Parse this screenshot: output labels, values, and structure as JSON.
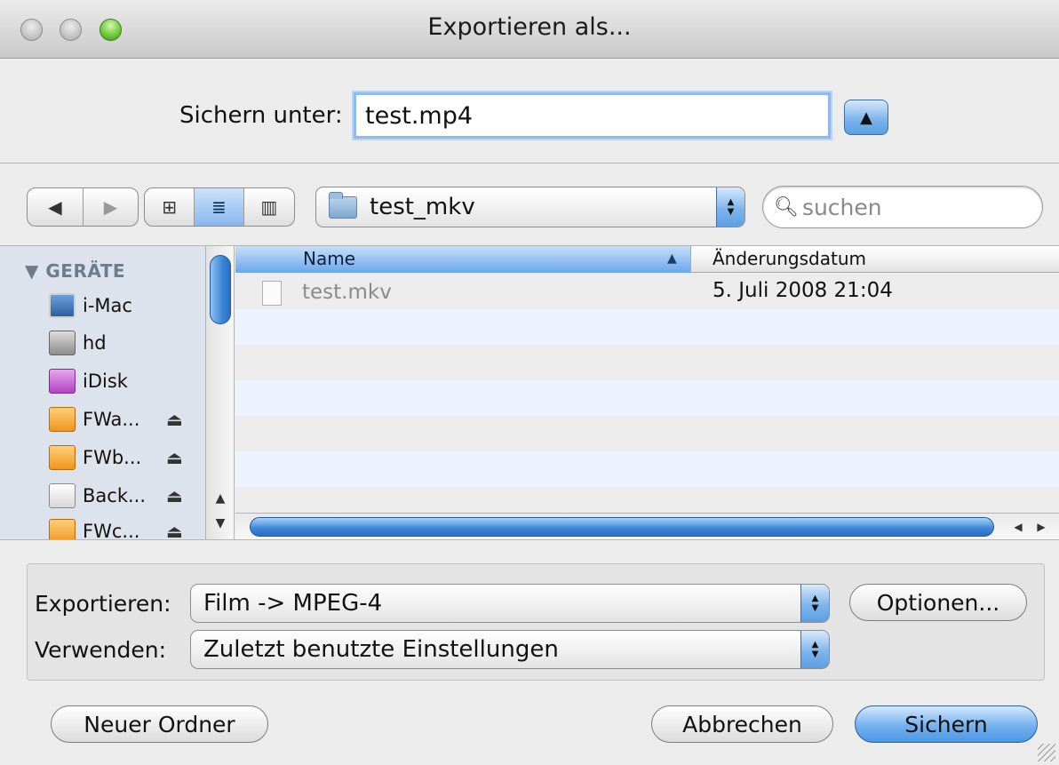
{
  "window": {
    "title": "Exportieren als..."
  },
  "save_as": {
    "label": "Sichern unter:",
    "value": "test.mp4"
  },
  "location": {
    "folder": "test_mkv"
  },
  "search": {
    "placeholder": "suchen"
  },
  "sidebar": {
    "section": "GERÄTE",
    "items": [
      {
        "label": "i-Mac",
        "icon": "imac-icon",
        "eject": false
      },
      {
        "label": "hd",
        "icon": "hard-drive-icon",
        "eject": false
      },
      {
        "label": "iDisk",
        "icon": "idisk-icon",
        "eject": false
      },
      {
        "label": "FWa...",
        "icon": "firewire-drive-icon",
        "eject": true
      },
      {
        "label": "FWb...",
        "icon": "firewire-drive-icon",
        "eject": true
      },
      {
        "label": "Back...",
        "icon": "backup-drive-icon",
        "eject": true
      },
      {
        "label": "FWc...",
        "icon": "firewire-drive-icon",
        "eject": true
      }
    ]
  },
  "file_list": {
    "columns": {
      "name": "Name",
      "date": "Änderungsdatum"
    },
    "files": [
      {
        "name": "test.mkv",
        "date": "5. Juli 2008 21:04"
      }
    ]
  },
  "export": {
    "export_label": "Exportieren:",
    "export_value": "Film -> MPEG-4",
    "use_label": "Verwenden:",
    "use_value": "Zuletzt benutzte Einstellungen",
    "options_button": "Optionen..."
  },
  "buttons": {
    "new_folder": "Neuer Ordner",
    "cancel": "Abbrechen",
    "save": "Sichern"
  },
  "colors": {
    "accent": "#5a9fe3",
    "selection": "#86b9ee",
    "sidebar": "#dce3ec",
    "row_alt": "#edf3fe"
  }
}
